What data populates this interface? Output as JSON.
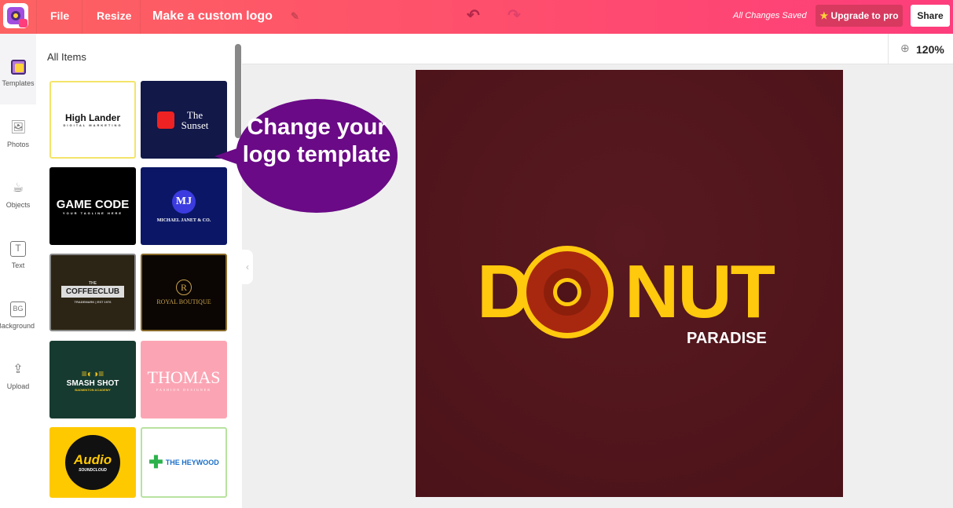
{
  "header": {
    "file": "File",
    "resize": "Resize",
    "title": "Make a custom logo",
    "status": "All Changes Saved",
    "upgrade": "Upgrade to pro",
    "share": "Share"
  },
  "sidebar": {
    "items": [
      {
        "label": "Templates",
        "icon": "template-icon"
      },
      {
        "label": "Photos",
        "icon": "image-icon"
      },
      {
        "label": "Objects",
        "icon": "cup-icon"
      },
      {
        "label": "Text",
        "icon": "text-icon"
      },
      {
        "label": "Background",
        "icon": "bg-icon",
        "glyph": "BG"
      },
      {
        "label": "Upload",
        "icon": "upload-icon"
      }
    ]
  },
  "panel": {
    "title": "All Items",
    "templates": [
      {
        "name": "High Lander",
        "sub": "DIGITAL MARKETING"
      },
      {
        "name": "The Sunset",
        "sub": ""
      },
      {
        "name": "GAME CODE",
        "sub": "YOUR TAGLINE HERE"
      },
      {
        "name": "MICHAEL JANET & CO.",
        "mono": "MJ"
      },
      {
        "name": "COFFEECLUB",
        "sub": "TRADEMARK | EST 1976",
        "top": "THE"
      },
      {
        "name": "ROYAL BOUTIQUE",
        "mono": "R"
      },
      {
        "name": "SMASH SHOT",
        "sub": "BADMINTON ACADEMY"
      },
      {
        "name": "THOMAS",
        "sub": "FASHION DESIGNER"
      },
      {
        "name": "Audio",
        "sub": "SOUNDCLOUD"
      },
      {
        "name": "THE HEYWOOD",
        "sub": ""
      }
    ]
  },
  "callout": "Change your logo template",
  "toolbar": {
    "zoom": "120%"
  },
  "canvas": {
    "title": "DUNUT",
    "word_left": "D",
    "word_right": "NUT",
    "subtitle": "PARADISE",
    "background": "#4e1419",
    "accent": "#ffc90d"
  }
}
